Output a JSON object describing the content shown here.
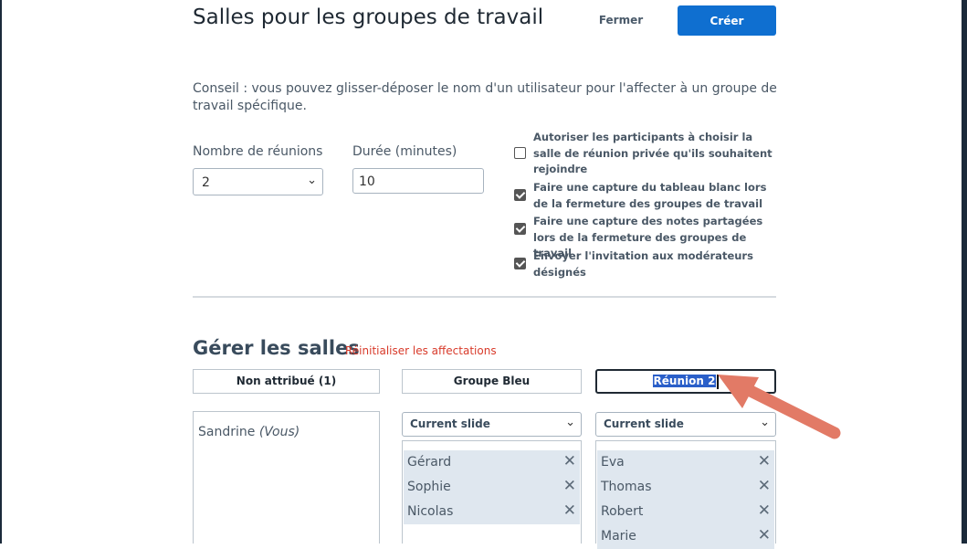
{
  "dialog": {
    "title": "Salles pour les groupes de travail",
    "close_label": "Fermer",
    "create_label": "Créer"
  },
  "tip": "Conseil : vous pouvez glisser-déposer le nom d'un utilisateur pour l'affecter à un groupe de travail spécifique.",
  "meetings": {
    "label": "Nombre de réunions",
    "value": "2"
  },
  "duration": {
    "label": "Durée (minutes)",
    "value": "10"
  },
  "options": [
    {
      "label": "Autoriser les participants à choisir la salle de réunion privée qu'ils souhaitent rejoindre",
      "checked": false
    },
    {
      "label": "Faire une capture du tableau blanc lors de la fermeture des groupes de travail",
      "checked": true
    },
    {
      "label": "Faire une capture des notes partagées lors de la fermeture des groupes de travail",
      "checked": true
    },
    {
      "label": "Envoyer l'invitation aux modérateurs désignés",
      "checked": true
    }
  ],
  "manage": {
    "title": "Gérer les salles",
    "reset_label": "Réinitialiser les affectations"
  },
  "rooms": {
    "unassigned": {
      "label": "Non attribué (1)",
      "user": "Sandrine",
      "user_suffix": "(Vous)"
    },
    "blue": {
      "label": "Groupe Bleu",
      "slide": "Current slide",
      "members": [
        "Gérard",
        "Sophie",
        "Nicolas"
      ]
    },
    "room2": {
      "label": "Réunion 2",
      "slide": "Current slide",
      "members": [
        "Eva",
        "Thomas",
        "Robert",
        "Marie"
      ]
    }
  },
  "colors": {
    "accent": "#0f6fd0",
    "link": "#d83a2a",
    "arrow": "#e27a66",
    "member_bg": "#dfe7ef"
  },
  "icons": {
    "remove": "close-icon",
    "dropdown": "chevron-down-icon",
    "checkbox": "checkbox-icon"
  }
}
